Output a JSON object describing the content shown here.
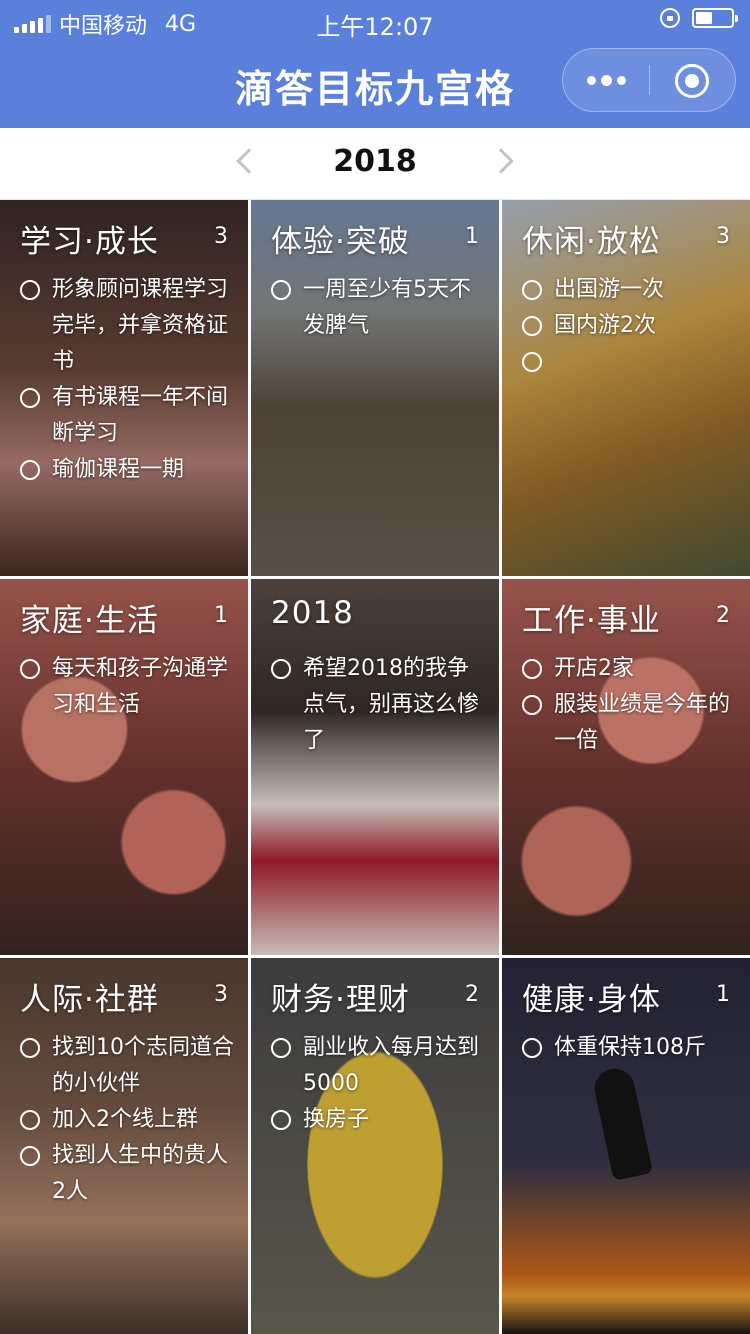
{
  "status_bar": {
    "carrier": "中国移动",
    "network": "4G",
    "time": "上午12:07"
  },
  "nav": {
    "title": "滴答目标九宫格"
  },
  "year_switcher": {
    "year": "2018"
  },
  "cells": [
    {
      "title": "学习·成长",
      "count": "3",
      "items": [
        "形象顾问课程学习完毕，并拿资格证书",
        "有书课程一年不间断学习",
        "瑜伽课程一期"
      ]
    },
    {
      "title": "体验·突破",
      "count": "1",
      "items": [
        "一周至少有5天不发脾气"
      ]
    },
    {
      "title": "休闲·放松",
      "count": "3",
      "items": [
        "出国游一次",
        "国内游2次",
        ""
      ]
    },
    {
      "title": "家庭·生活",
      "count": "1",
      "items": [
        "每天和孩子沟通学习和生活"
      ]
    },
    {
      "title": "2018",
      "count": "",
      "items": [
        "希望2018的我争点气，别再这么惨了"
      ]
    },
    {
      "title": "工作·事业",
      "count": "2",
      "items": [
        "开店2家",
        "服装业绩是今年的一倍"
      ]
    },
    {
      "title": "人际·社群",
      "count": "3",
      "items": [
        "找到10个志同道合的小伙伴",
        "加入2个线上群",
        "找到人生中的贵人2人"
      ]
    },
    {
      "title": "财务·理财",
      "count": "2",
      "items": [
        "副业收入每月达到5000",
        "换房子"
      ]
    },
    {
      "title": "健康·身体",
      "count": "1",
      "items": [
        "体重保持108斤"
      ]
    }
  ]
}
